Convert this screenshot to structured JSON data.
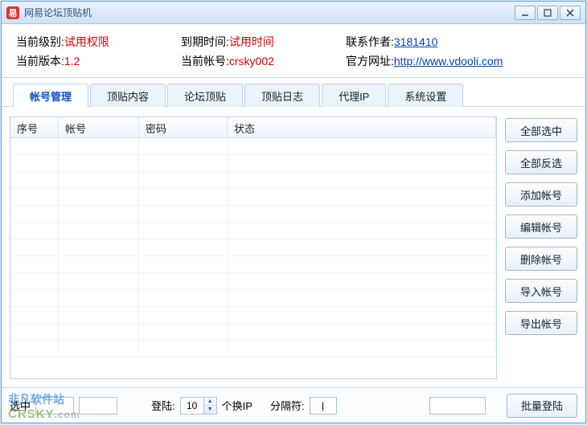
{
  "window": {
    "title": "网易论坛顶贴机"
  },
  "info": {
    "level_label": "当前级别:",
    "level_value": "试用权限",
    "expire_label": "到期时间:",
    "expire_value": "试用时间",
    "contact_label": "联系作者:",
    "contact_value": "3181410",
    "version_label": "当前版本:",
    "version_value": "1.2",
    "account_label": "当前帐号:",
    "account_value": "crsky002",
    "site_label": "官方网址:",
    "site_value": "http://www.vdooli.com"
  },
  "tabs": [
    "帐号管理",
    "顶贴内容",
    "论坛顶贴",
    "顶贴日志",
    "代理IP",
    "系统设置"
  ],
  "columns": [
    "序号",
    "帐号",
    "密码",
    "状态"
  ],
  "sideButtons": [
    "全部选中",
    "全部反选",
    "添加帐号",
    "编辑帐号",
    "删除帐号",
    "导入帐号",
    "导出帐号"
  ],
  "bottom": {
    "select_label": "选中",
    "login_label": "登陆:",
    "login_value": "10",
    "login_suffix": "个换IP",
    "sep_label": "分隔符:",
    "sep_value": "|",
    "batch_button": "批量登陆"
  },
  "watermark": {
    "line1": "非凡软件站",
    "line2": "CRSKY",
    "line2_suffix": ".com"
  }
}
